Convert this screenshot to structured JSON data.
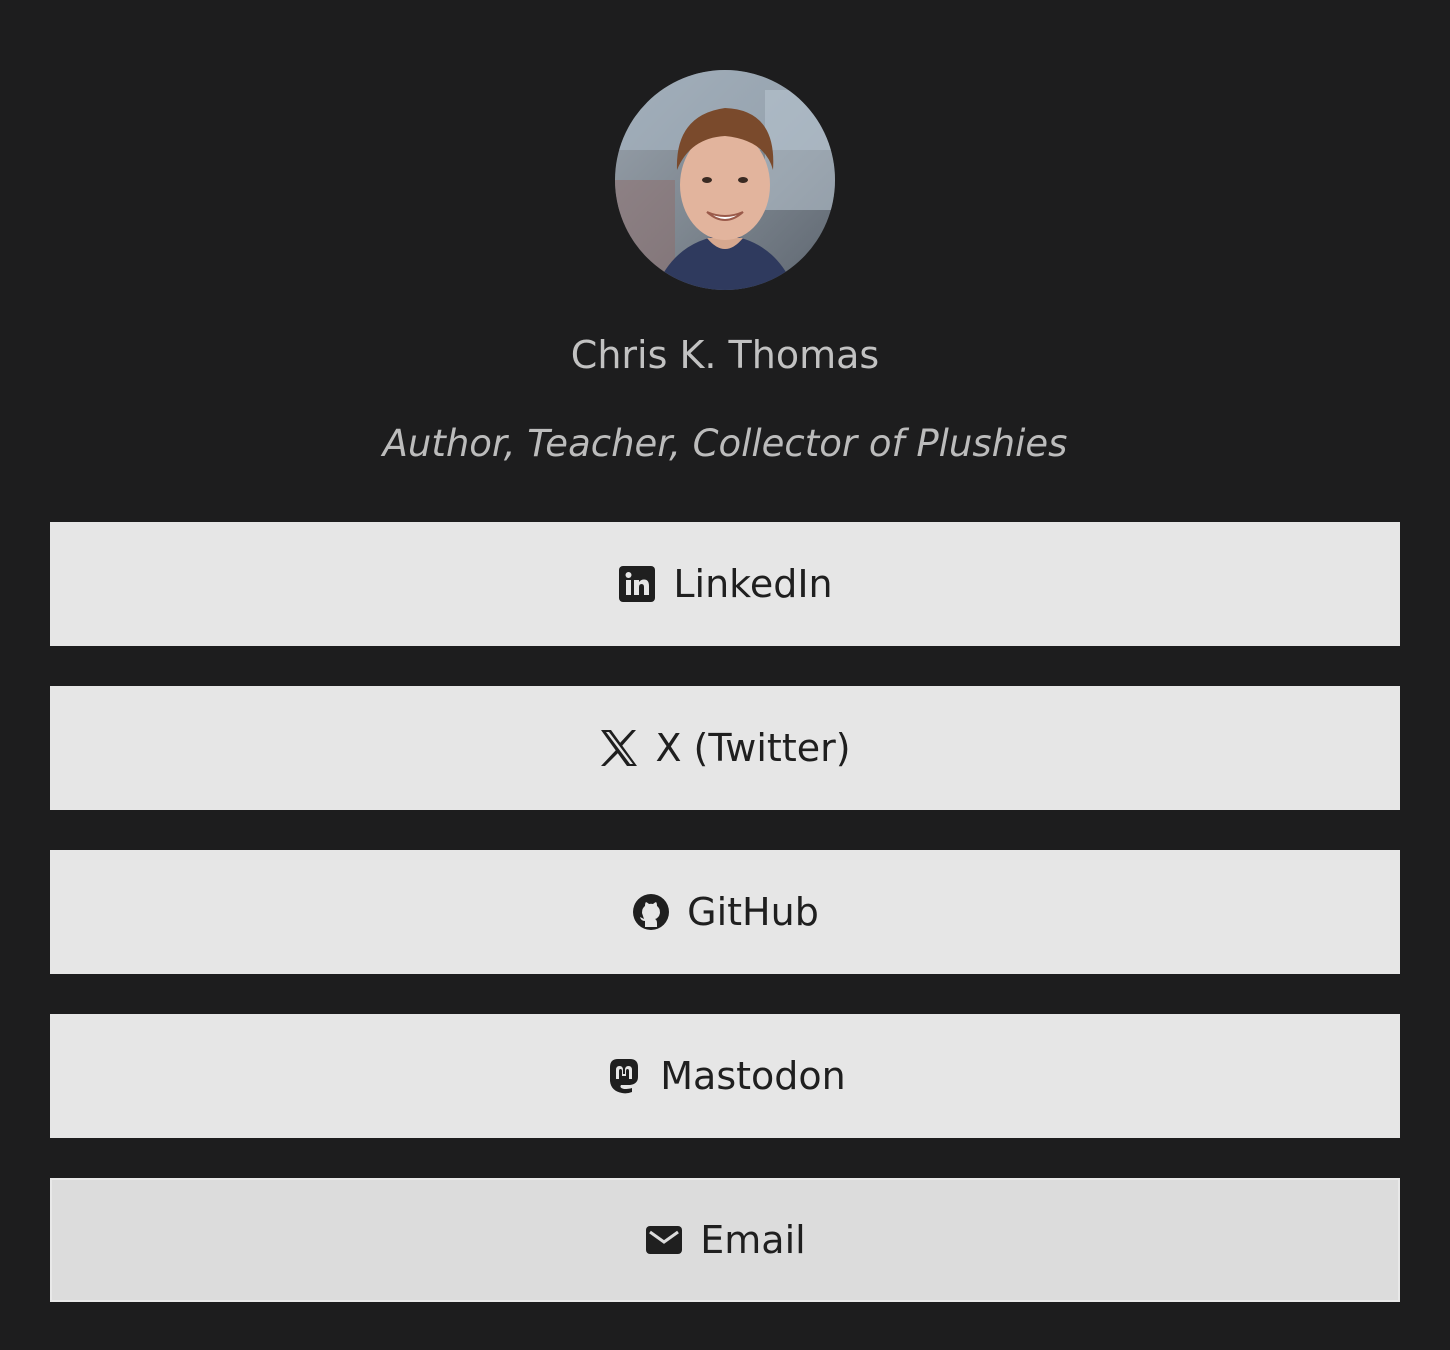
{
  "profile": {
    "name": "Chris K. Thomas",
    "tagline": "Author, Teacher, Collector of Plushies",
    "avatar_icon": "person-photo-icon"
  },
  "links": [
    {
      "label": "LinkedIn",
      "icon": "linkedin-icon"
    },
    {
      "label": "X (Twitter)",
      "icon": "x-twitter-icon"
    },
    {
      "label": "GitHub",
      "icon": "github-icon"
    },
    {
      "label": "Mastodon",
      "icon": "mastodon-icon"
    },
    {
      "label": "Email",
      "icon": "email-icon"
    }
  ],
  "colors": {
    "background": "#1d1d1e",
    "button": "#e6e6e6",
    "button_hover": "#dcdcdc",
    "text_dark": "#1f1f1f",
    "text_light": "#c2c2c2"
  }
}
